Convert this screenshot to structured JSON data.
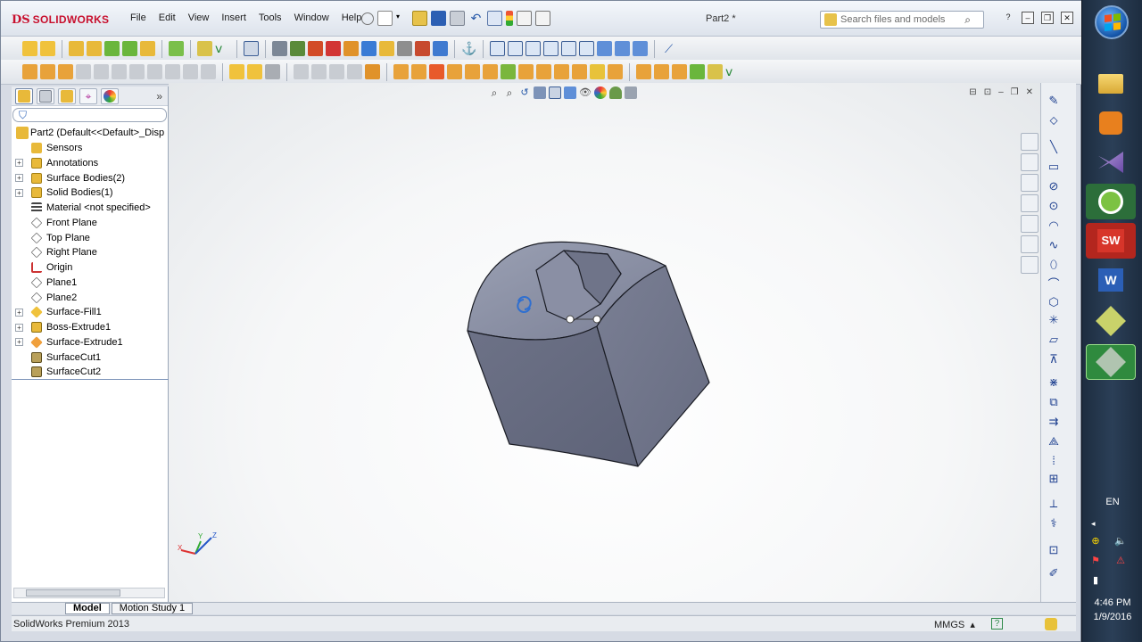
{
  "app": {
    "logo_ds": "DS",
    "logo_name": "SOLIDWORKS",
    "document_title": "Part2 *",
    "search_placeholder": "Search files and models",
    "menus": [
      "File",
      "Edit",
      "View",
      "Insert",
      "Tools",
      "Window",
      "Help"
    ],
    "accent_color": "#c8102e"
  },
  "feature_tree": {
    "root_label": "Part2  (Default<<Default>_Disp",
    "items": [
      {
        "label": "Sensors",
        "icon": "sensors-icon",
        "expandable": false
      },
      {
        "label": "Annotations",
        "icon": "annotations-icon",
        "expandable": true
      },
      {
        "label": "Surface Bodies(2)",
        "icon": "surface-bodies-icon",
        "expandable": true
      },
      {
        "label": "Solid Bodies(1)",
        "icon": "solid-bodies-icon",
        "expandable": true
      },
      {
        "label": "Material <not specified>",
        "icon": "material-icon",
        "expandable": false
      },
      {
        "label": "Front Plane",
        "icon": "plane-icon",
        "expandable": false
      },
      {
        "label": "Top Plane",
        "icon": "plane-icon",
        "expandable": false
      },
      {
        "label": "Right Plane",
        "icon": "plane-icon",
        "expandable": false
      },
      {
        "label": "Origin",
        "icon": "origin-icon",
        "expandable": false
      },
      {
        "label": "Plane1",
        "icon": "plane-icon",
        "expandable": false
      },
      {
        "label": "Plane2",
        "icon": "plane-icon",
        "expandable": false
      },
      {
        "label": "Surface-Fill1",
        "icon": "surface-fill-icon",
        "expandable": true
      },
      {
        "label": "Boss-Extrude1",
        "icon": "boss-extrude-icon",
        "expandable": true
      },
      {
        "label": "Surface-Extrude1",
        "icon": "surface-extrude-icon",
        "expandable": true
      },
      {
        "label": "SurfaceCut1",
        "icon": "surface-cut-icon",
        "expandable": false
      },
      {
        "label": "SurfaceCut2",
        "icon": "surface-cut-icon",
        "expandable": false
      }
    ]
  },
  "bottom_tabs": {
    "model": "Model",
    "motion_study": "Motion Study 1"
  },
  "status": {
    "product": "SolidWorks Premium 2013",
    "units": "MMGS",
    "units_arrow": "▴",
    "help": "?"
  },
  "triad": {
    "x": "X",
    "y": "Y",
    "z": "Z"
  },
  "taskbar": {
    "language": "EN",
    "time": "4:46 PM",
    "date": "1/9/2016"
  }
}
